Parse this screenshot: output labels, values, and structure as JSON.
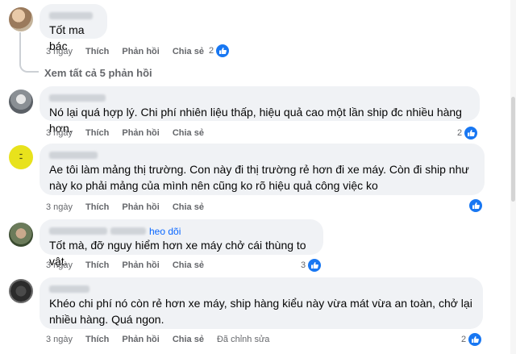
{
  "comments": [
    {
      "text": "Tốt ma bác",
      "time": "3 ngày",
      "like": "Thích",
      "reply": "Phản hồi",
      "share": "Chia sẻ",
      "reactions": "2"
    },
    {
      "text": "Nó lại quá hợp lý. Chi phí nhiên liệu thấp, hiệu quả cao một lần ship đc nhiều hàng hơn.",
      "time": "3 ngày",
      "like": "Thích",
      "reply": "Phản hồi",
      "share": "Chia sẻ",
      "reactions": "2"
    },
    {
      "text": "Ae tôi làm mảng thị trường. Con này đi thị trường rẻ hơn đi xe máy. Còn đi ship như này ko phải mảng của mình nên cũng ko rõ hiệu quả công việc ko",
      "time": "3 ngày",
      "like": "Thích",
      "reply": "Phản hồi",
      "share": "Chia sẻ",
      "reactions": ""
    },
    {
      "follow": "heo dõi",
      "text": "Tốt mà, đỡ nguy hiểm hơn xe máy chở cái thùng to vật.",
      "time": "3 ngày",
      "like": "Thích",
      "reply": "Phản hồi",
      "share": "Chia sẻ",
      "reactions": "3"
    },
    {
      "text": "Khéo chi phí nó còn rẻ hơn xe máy, ship hàng kiểu này vừa mát vừa an toàn, chở lại nhiều hàng. Quá ngon.",
      "time": "3 ngày",
      "like": "Thích",
      "reply": "Phản hồi",
      "share": "Chia sẻ",
      "edited": "Đã chỉnh sửa",
      "reactions": "2"
    }
  ],
  "view_replies": "Xem tất cả 5 phản hồi",
  "colors": {
    "link": "#0866ff",
    "bubble": "#f0f2f5",
    "meta": "#65676b",
    "like": "#1877f2"
  },
  "icons": {
    "like": "thumbs-up-icon"
  }
}
